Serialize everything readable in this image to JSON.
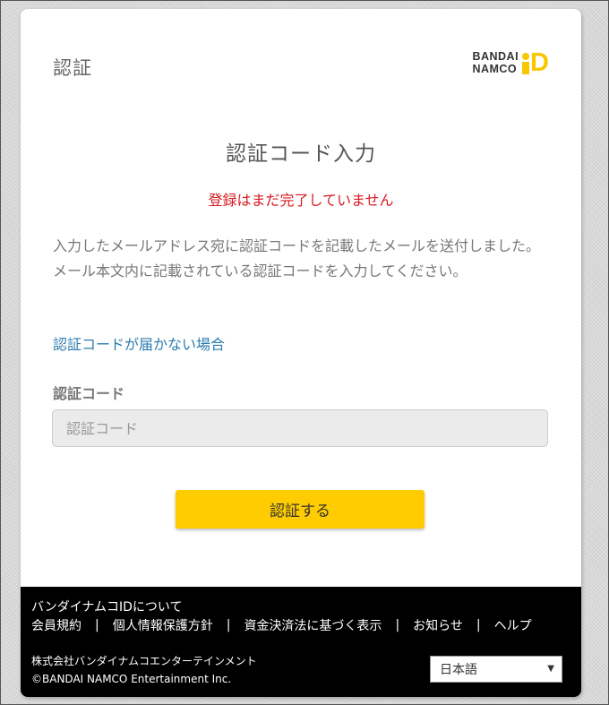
{
  "header": {
    "title": "認証",
    "logo": {
      "line1": "BANDAI",
      "line2": "NAMCO",
      "mark": "D",
      "accent_color": "#f8c700"
    }
  },
  "main": {
    "heading": "認証コード入力",
    "error_message": "登録はまだ完了していません",
    "description_line1": "入力したメールアドレス宛に認証コードを記載したメールを送付しました。",
    "description_line2": "メール本文内に記載されている認証コードを入力してください。",
    "help_link": "認証コードが届かない場合",
    "code_field": {
      "label": "認証コード",
      "placeholder": "認証コード",
      "value": ""
    },
    "submit_label": "認証する",
    "button_color": "#fecc00",
    "error_color": "#d71920",
    "link_color": "#2e7bb0"
  },
  "footer": {
    "about": "バンダイナムコIDについて",
    "links": [
      "会員規約",
      "個人情報保護方針",
      "資金決済法に基づく表示",
      "お知らせ",
      "ヘルプ"
    ],
    "separator": "|",
    "company": "株式会社バンダイナムコエンターテインメント",
    "copyright": "©BANDAI NAMCO Entertainment Inc.",
    "language": {
      "selected": "日本語",
      "arrow": "▼"
    }
  }
}
